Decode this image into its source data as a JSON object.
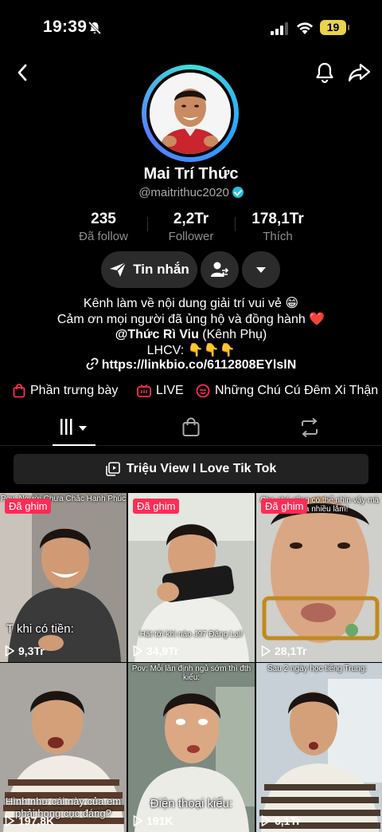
{
  "status_bar": {
    "time": "19:39",
    "battery": "19"
  },
  "profile": {
    "name": "Mai Trí Thức",
    "handle": "@maitrithuc2020",
    "stats": [
      {
        "value": "235",
        "label": "Đã follow"
      },
      {
        "value": "2,2Tr",
        "label": "Follower"
      },
      {
        "value": "178,1Tr",
        "label": "Thích"
      }
    ],
    "message_button": "Tin nhắn",
    "bio": {
      "line1": "Kênh làm về nội dung giải trí vui vẻ 😁",
      "line2": "Cảm ơn mọi người đã ủng hộ và đồng hành ❤️",
      "line3_bold": "@Thức Rì Viu",
      "line3_rest": " (Kênh Phụ)",
      "line4": "LHCV: 👇👇👇",
      "link": "https://linkbio.co/6112808EYlslN"
    }
  },
  "pills": [
    {
      "label": "Phần trưng bày"
    },
    {
      "label": "LIVE"
    },
    {
      "label": "Những Chú Cú Đêm Xi Thận"
    }
  ],
  "playlist": {
    "label": "Triệu View I Love Tik Tok"
  },
  "videos": [
    {
      "pinned": "Đã ghim",
      "views": "9,3Tr",
      "caption": "T khi có tiền:",
      "top_caption": "Pov: Người Chưa Chắc Hạnh Phúc"
    },
    {
      "pinned": "Đã ghim",
      "views": "34,9Tr",
      "caption": "Hát tới khi nào J97 Đăng Lại!",
      "top_caption": ""
    },
    {
      "pinned": "Đã ghim",
      "views": "28,1Tr",
      "caption": "",
      "top_caption": "Cho chó cũng có thể nhìn vậy mà nó ra nhiều lắm!"
    },
    {
      "pinned": "",
      "views": "197,8K",
      "caption": "Hình như cái này của em phải hong cục đáng?",
      "top_caption": ""
    },
    {
      "pinned": "",
      "views": "191K",
      "caption": "Điện thoại kiểu:",
      "top_caption": "Pov: Mỗi lần định ngủ sớm thì đth kiểu:"
    },
    {
      "pinned": "",
      "views": "6,1Tr",
      "caption": "",
      "top_caption": "Sau 2 ngày học tiếng Trung:"
    }
  ],
  "colors": {
    "pin": "#fe2c55",
    "accent_ring": "#3ee0d4",
    "verified": "#20c0e8"
  }
}
